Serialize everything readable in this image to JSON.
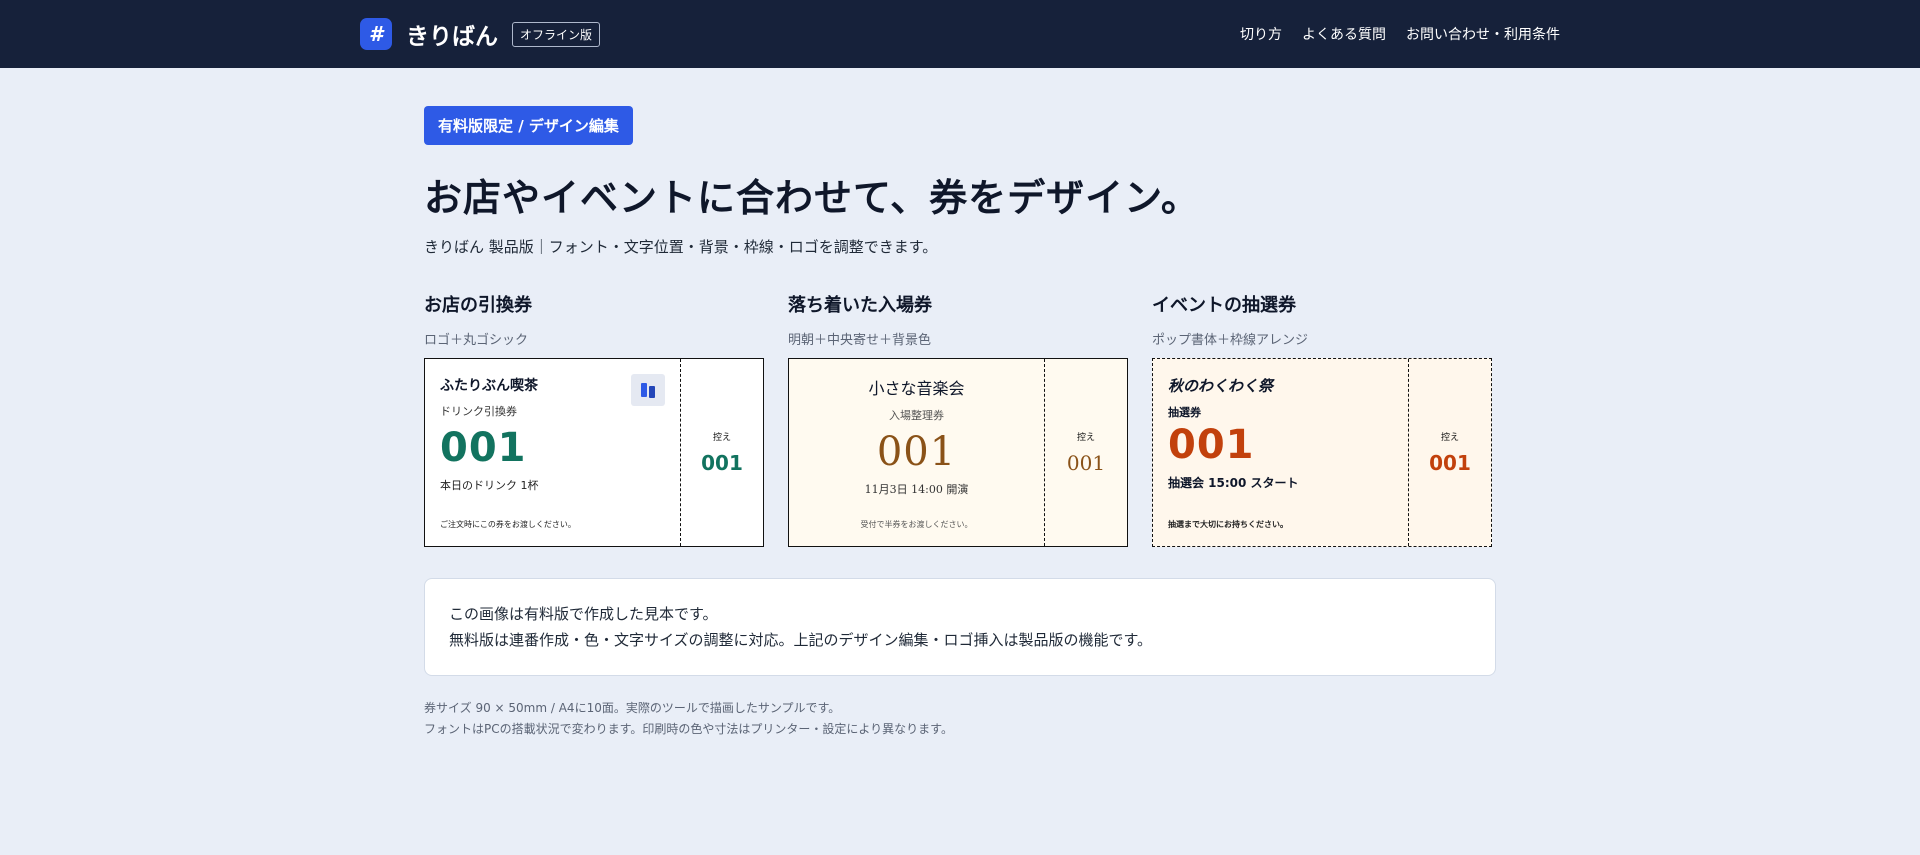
{
  "header": {
    "logo_glyph": "#",
    "brand": "きりばん",
    "badge": "オフライン版",
    "nav": [
      "切り方",
      "よくある質問",
      "お問い合わせ・利用条件"
    ]
  },
  "hero": {
    "pill": "有料版限定 / デザイン編集",
    "title": "お店やイベントに合わせて、券をデザイン。",
    "subtitle": "きりばん 製品版｜フォント・文字位置・背景・枠線・ロゴを調整できます。"
  },
  "samples": [
    {
      "title": "お店の引換券",
      "subtitle": "ロゴ＋丸ゴシック",
      "ticket": {
        "shop": "ふたりぶん喫茶",
        "kind": "ドリンク引換券",
        "number": "001",
        "desc": "本日のドリンク 1杯",
        "note": "ご注文時にこの券をお渡しください。",
        "stub_label": "控え",
        "stub_number": "001"
      }
    },
    {
      "title": "落ち着いた入場券",
      "subtitle": "明朝＋中央寄せ＋背景色",
      "ticket": {
        "shop": "小さな音楽会",
        "kind": "入場整理券",
        "number": "001",
        "desc": "11月3日 14:00 開演",
        "note": "受付で半券をお渡しください。",
        "stub_label": "控え",
        "stub_number": "001"
      }
    },
    {
      "title": "イベントの抽選券",
      "subtitle": "ポップ書体＋枠線アレンジ",
      "ticket": {
        "shop": "秋のわくわく祭",
        "kind": "抽選券",
        "number": "001",
        "desc": "抽選会 15:00 スタート",
        "note": "抽選まで大切にお持ちください。",
        "stub_label": "控え",
        "stub_number": "001"
      }
    }
  ],
  "info": {
    "line1": "この画像は有料版で作成した見本です。",
    "line2": "無料版は連番作成・色・文字サイズの調整に対応。上記のデザイン編集・ロゴ挿入は製品版の機能です。"
  },
  "footnote": {
    "line1": "券サイズ 90 × 50mm / A4に10面。実際のツールで描画したサンプルです。",
    "line2": "フォントはPCの搭載状況で変わります。印刷時の色や寸法はプリンター・設定により異なります。"
  },
  "colors": {
    "header_bg": "#16213a",
    "accent": "#2e5ae6",
    "ticket1_number": "#12735f",
    "ticket2_number": "#8a5218",
    "ticket3_number": "#c2410c"
  }
}
